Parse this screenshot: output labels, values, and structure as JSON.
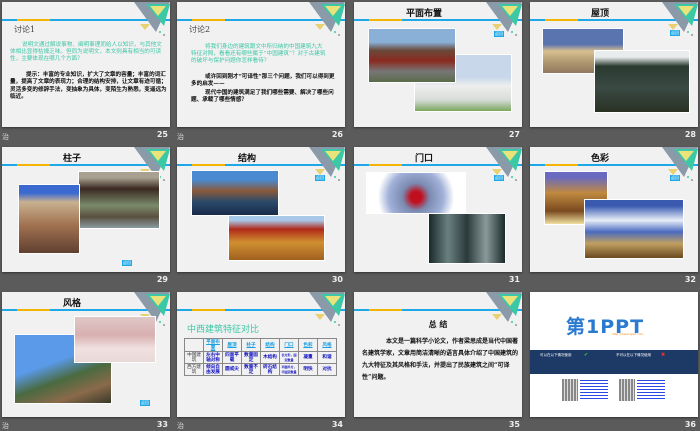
{
  "slide_marker": "治",
  "slides": [
    {
      "number": "25",
      "title": "讨论1",
      "green_text": "说明文通过解说事物、阐明事理而给人以知识，与其他文体相比显得枯燥乏味。但同为说明文，本文则具有相当的可读性，主要体现在哪几个方面？",
      "black_text": "提示：丰富的专业知识，扩大了文章的容量；丰富的词汇量，提高了文章的表现力；合理的结构安排，让文章有迹可循；灵活多变的修辞手法，变抽象为具体，变陌生为熟悉，变遥远为临近。"
    },
    {
      "number": "26",
      "title": "讨论2",
      "green_text": "将我们身边的建筑跟文中所归纳的中国建筑九大特征对照，看看还有哪些属于“中国建筑”？对于古建筑的破坏与保护问题你怎样看待？",
      "black_text_1": "或许回到刚才“可译性”那三个问题，我们可以得到更多的启发——",
      "black_text_2": "现代中国的建筑满足了我们哪些需要、解决了哪些问题、承载了哪些情感？"
    },
    {
      "number": "27",
      "title": "平面布置",
      "back": "返回"
    },
    {
      "number": "28",
      "title": "屋顶",
      "back": "返回"
    },
    {
      "number": "29",
      "title": "柱子",
      "back": "返回"
    },
    {
      "number": "30",
      "title": "结构",
      "back": "返回"
    },
    {
      "number": "31",
      "title": "门口",
      "back": "返回"
    },
    {
      "number": "32",
      "title": "色彩",
      "back": "返回"
    },
    {
      "number": "33",
      "title": "风格",
      "back": "返回"
    },
    {
      "number": "34",
      "title": "中西建筑特征对比",
      "table": {
        "headers": [
          "",
          "平面布置",
          "屋顶",
          "柱子",
          "结构",
          "门口",
          "色彩",
          "风格"
        ],
        "rows": [
          [
            "中国建筑",
            "左右中轴对称",
            "四面平载",
            "数量固定",
            "木结构",
            "长方形，固定数量",
            "凝重",
            "和谐"
          ],
          [
            "西方建筑",
            "倾向自由发展",
            "圆或尖",
            "数量不定",
            "砖石结构",
            "半圆半方，不固定数量",
            "明快",
            "对抗"
          ]
        ]
      }
    },
    {
      "number": "35",
      "title": "总 结",
      "body": "本文是一篇科学小论文，作者梁思成是当代中国著名建筑学家，文章用简洁清晰的语言具体介绍了中国建筑的九大特征及其风格和手法，并提出了民族建筑之间“可译性”问题。"
    },
    {
      "number": "36",
      "logo": "第1PPT",
      "logo_url": "http://www.1ppt.com",
      "can_use": "可以在以下情况使用",
      "cannot_use": "不可以在以下情况使用"
    }
  ],
  "colors": {
    "accent_blue": "#1fa8e8",
    "accent_yellow": "#f5b400",
    "teal": "#3cc7a6",
    "navy": "#1d3a66"
  }
}
